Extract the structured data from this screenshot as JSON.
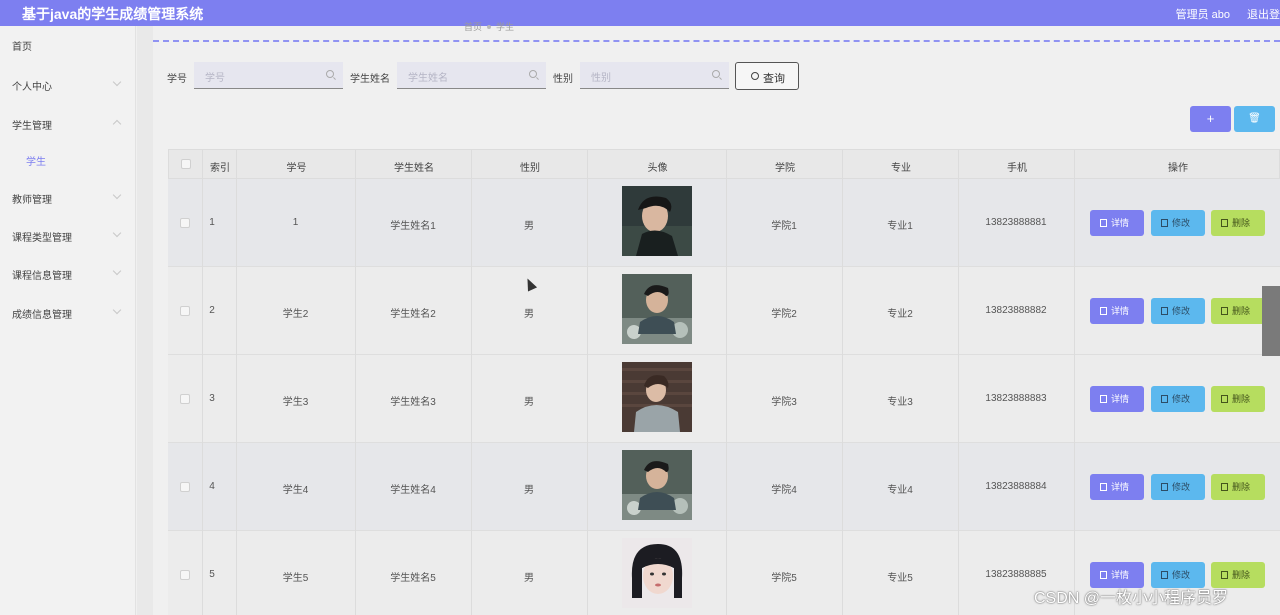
{
  "app": {
    "title": "基于java的学生成绩管理系统",
    "user": "管理员 abo",
    "logout": "退出登"
  },
  "sidebar": {
    "items": [
      {
        "label": "首页",
        "arrow": "none"
      },
      {
        "label": "个人中心",
        "arrow": "down"
      },
      {
        "label": "学生管理",
        "arrow": "up"
      },
      {
        "label": "学生",
        "arrow": "none",
        "sub": true
      },
      {
        "label": "教师管理",
        "arrow": "down"
      },
      {
        "label": "课程类型管理",
        "arrow": "down"
      },
      {
        "label": "课程信息管理",
        "arrow": "down"
      },
      {
        "label": "成绩信息管理",
        "arrow": "down"
      }
    ]
  },
  "breadcrumb": {
    "home": "首页",
    "current": "学生"
  },
  "search": {
    "id_label": "学号",
    "id_placeholder": "学号",
    "name_label": "学生姓名",
    "name_placeholder": "学生姓名",
    "gender_label": "性别",
    "gender_placeholder": "性别",
    "query_label": "查询"
  },
  "toolbar": {
    "add_label": "+",
    "delete_label": "🗑"
  },
  "table": {
    "headers": [
      "索引",
      "学号",
      "学生姓名",
      "性别",
      "头像",
      "学院",
      "专业",
      "手机",
      "操作"
    ],
    "actions": {
      "detail": "详情",
      "edit": "修改",
      "delete": "删除"
    },
    "rows": [
      {
        "index": "1",
        "id": "1",
        "name": "学生姓名1",
        "gender": "男",
        "college": "学院1",
        "major": "专业1",
        "phone": "13823888881"
      },
      {
        "index": "2",
        "id": "学生2",
        "name": "学生姓名2",
        "gender": "男",
        "college": "学院2",
        "major": "专业2",
        "phone": "13823888882"
      },
      {
        "index": "3",
        "id": "学生3",
        "name": "学生姓名3",
        "gender": "男",
        "college": "学院3",
        "major": "专业3",
        "phone": "13823888883"
      },
      {
        "index": "4",
        "id": "学生4",
        "name": "学生姓名4",
        "gender": "男",
        "college": "学院4",
        "major": "专业4",
        "phone": "13823888884"
      },
      {
        "index": "5",
        "id": "学生5",
        "name": "学生姓名5",
        "gender": "男",
        "college": "学院5",
        "major": "专业5",
        "phone": "13823888885"
      }
    ]
  },
  "watermark": "CSDN @一枚小小程序员罗",
  "colors": {
    "primary": "#7d7ff0",
    "edit": "#5cb8ee",
    "delete": "#b6dd5f"
  }
}
